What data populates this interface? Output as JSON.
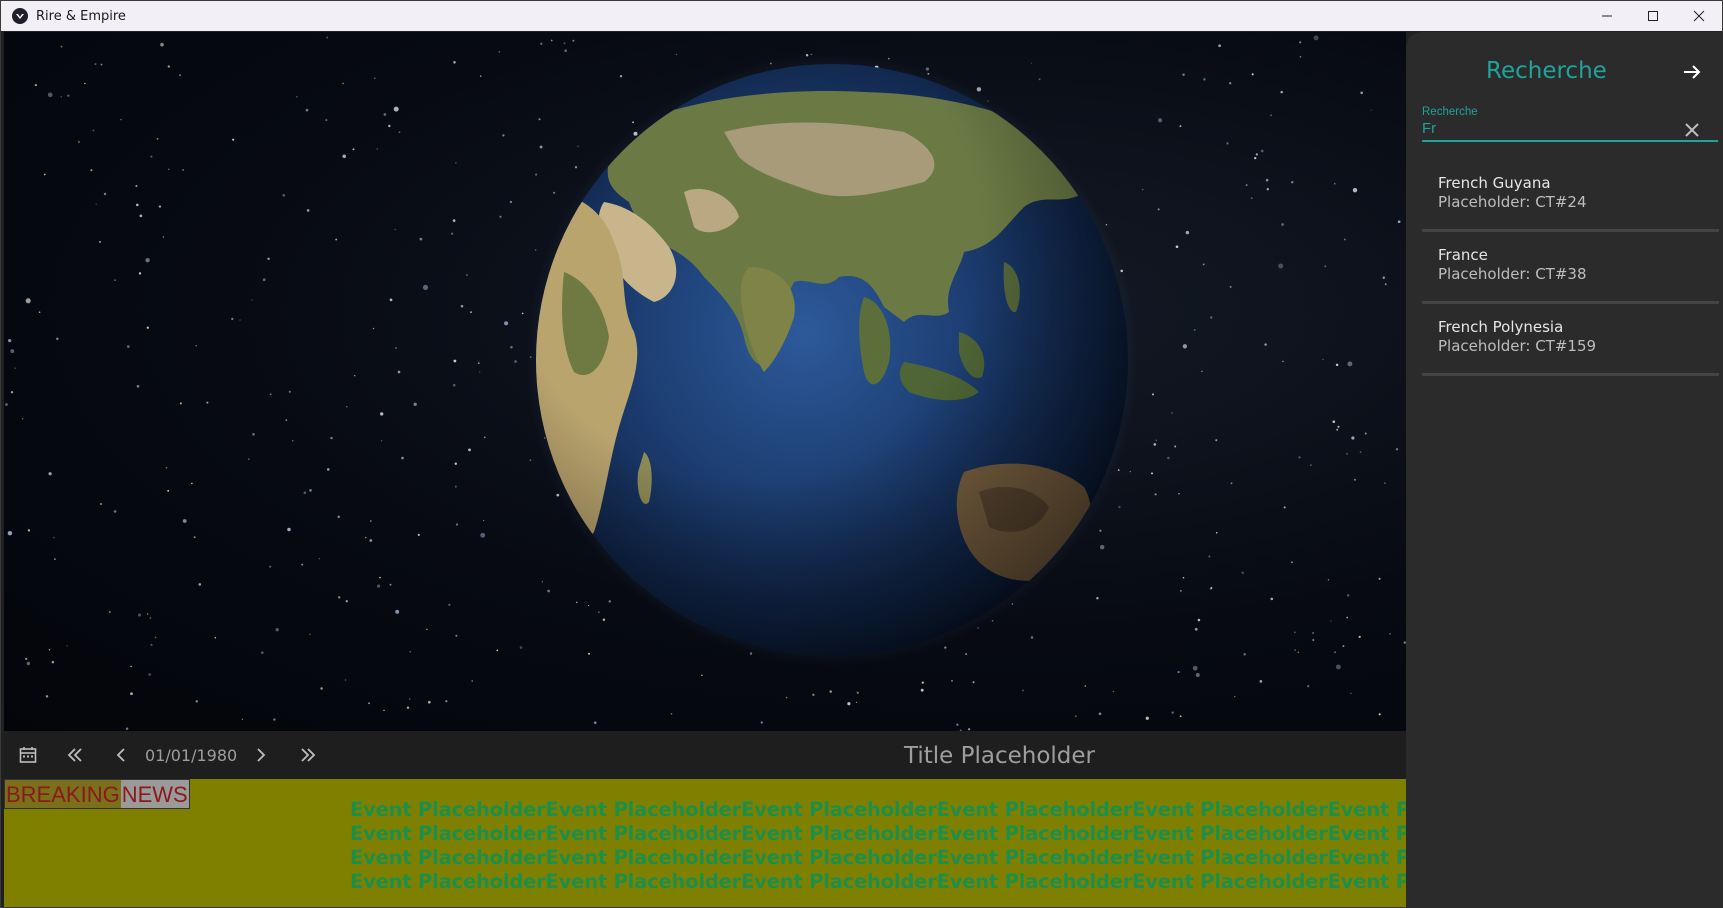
{
  "window": {
    "title": "Rire & Empire",
    "controls": [
      "minimize-icon",
      "maximize-icon",
      "close-icon"
    ]
  },
  "controlbar": {
    "date": "01/01/1980",
    "title": "Title Placeholder",
    "icons": [
      "calendar-icon",
      "double-chevron-left-icon",
      "chevron-left-icon",
      "chevron-right-icon",
      "double-chevron-right-icon"
    ]
  },
  "news": {
    "breaking_part1": "BREAKING",
    "breaking_part2": "NEWS",
    "lines": [
      "Event PlaceholderEvent PlaceholderEvent PlaceholderEvent PlaceholderEvent PlaceholderEvent Placeholder",
      "Event PlaceholderEvent PlaceholderEvent PlaceholderEvent PlaceholderEvent PlaceholderEvent Placeholder",
      "Event PlaceholderEvent PlaceholderEvent PlaceholderEvent PlaceholderEvent PlaceholderEvent Placeholder",
      "Event PlaceholderEvent PlaceholderEvent PlaceholderEvent PlaceholderEvent PlaceholderEvent Placeholder"
    ]
  },
  "search_panel": {
    "title": "Recherche",
    "field_label": "Recherche",
    "field_value": "Fr",
    "results": [
      {
        "name": "French Guyana",
        "sub": "Placeholder: CT#24"
      },
      {
        "name": "France",
        "sub": "Placeholder: CT#38"
      },
      {
        "name": "French Polynesia",
        "sub": "Placeholder: CT#159"
      }
    ]
  },
  "colors": {
    "accent": "#20a39b",
    "news_bg": "#808000",
    "news_text": "#1e8f4a",
    "breaking_text": "#8b1a1a"
  }
}
